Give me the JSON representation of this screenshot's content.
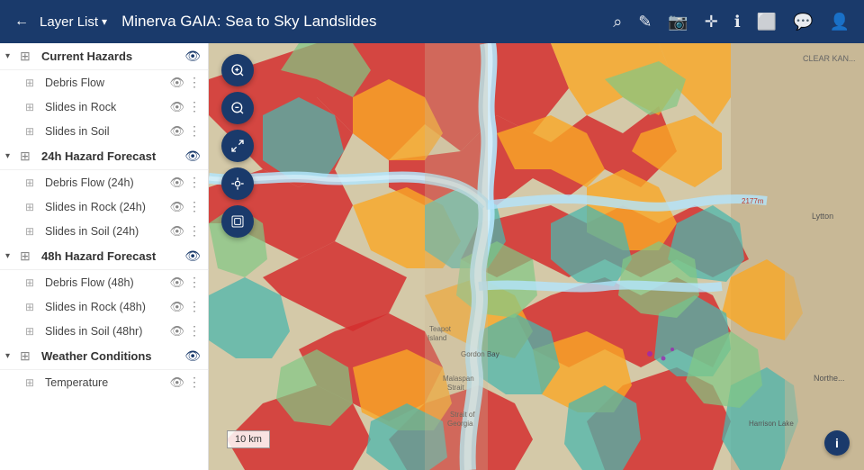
{
  "header": {
    "title": "Minerva GAIA: Sea to Sky Landslides",
    "back_icon": "←",
    "layer_list_label": "Layer List",
    "dropdown_icon": "▾",
    "icons": [
      {
        "name": "search-icon",
        "symbol": "🔍"
      },
      {
        "name": "cursor-icon",
        "symbol": "✏️"
      },
      {
        "name": "camera-icon",
        "symbol": "📷"
      },
      {
        "name": "move-icon",
        "symbol": "✛"
      },
      {
        "name": "info-icon",
        "symbol": "ℹ"
      },
      {
        "name": "monitor-icon",
        "symbol": "🖥"
      },
      {
        "name": "chat-icon",
        "symbol": "💬"
      },
      {
        "name": "account-icon",
        "symbol": "👤"
      }
    ]
  },
  "sidebar": {
    "groups": [
      {
        "id": "current-hazards",
        "label": "Current Hazards",
        "expanded": true,
        "visible": true,
        "layers": [
          {
            "label": "Debris Flow",
            "visible": true,
            "has_more": true
          },
          {
            "label": "Slides in Rock",
            "visible": true,
            "has_more": true
          },
          {
            "label": "Slides in Soil",
            "visible": true,
            "has_more": true
          }
        ]
      },
      {
        "id": "24h-hazard",
        "label": "24h Hazard Forecast",
        "expanded": true,
        "visible": true,
        "layers": [
          {
            "label": "Debris Flow (24h)",
            "visible": true,
            "has_more": true
          },
          {
            "label": "Slides in Rock (24h)",
            "visible": true,
            "has_more": true
          },
          {
            "label": "Slides in Soil (24h)",
            "visible": true,
            "has_more": true
          }
        ]
      },
      {
        "id": "48h-hazard",
        "label": "48h Hazard Forecast",
        "expanded": true,
        "visible": true,
        "layers": [
          {
            "label": "Debris Flow (48h)",
            "visible": true,
            "has_more": true
          },
          {
            "label": "Slides in Rock (48h)",
            "visible": true,
            "has_more": true
          },
          {
            "label": "Slides in Soil (48hr)",
            "visible": true,
            "has_more": true
          }
        ]
      },
      {
        "id": "weather-conditions",
        "label": "Weather Conditions",
        "expanded": true,
        "visible": true,
        "layers": [
          {
            "label": "Temperature",
            "visible": true,
            "has_more": true
          }
        ]
      }
    ]
  },
  "map": {
    "toolbar": [
      {
        "name": "zoom-in",
        "symbol": "🔍"
      },
      {
        "name": "zoom-out",
        "symbol": "🔍"
      },
      {
        "name": "fullscreen",
        "symbol": "⤢"
      },
      {
        "name": "location",
        "symbol": "◎"
      },
      {
        "name": "layers",
        "symbol": "⊞"
      }
    ],
    "scale_label": "10 km",
    "info_label": "i"
  }
}
